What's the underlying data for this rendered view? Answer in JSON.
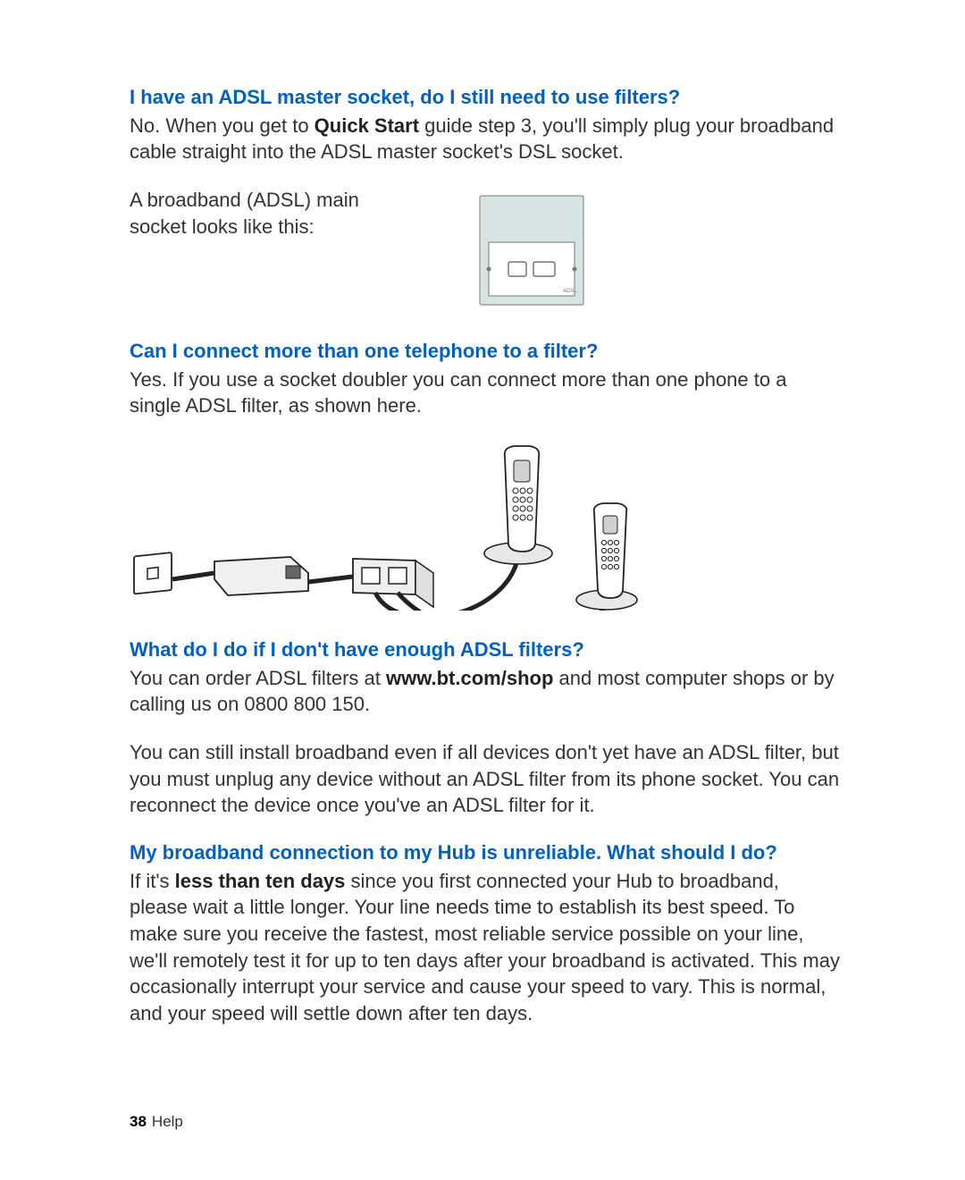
{
  "q1": {
    "question": "I have an ADSL master socket, do I still need to use filters?",
    "answer_pre": "No. When you get to ",
    "answer_bold": "Quick Start",
    "answer_post": " guide step 3, you'll simply plug your broadband cable straight into the ADSL master socket's DSL socket.",
    "caption": "A broadband (ADSL) main socket looks like this:"
  },
  "q2": {
    "question": "Can I connect more than one telephone to a filter?",
    "answer": "Yes. If you use a socket doubler you can connect more than one phone to a single ADSL filter, as shown here."
  },
  "q3": {
    "question": "What do I do if I don't have enough ADSL filters?",
    "p1_pre": "You can order ADSL filters at ",
    "p1_bold": "www.bt.com/shop",
    "p1_post": " and most computer shops or by calling us on 0800 800 150.",
    "p2": "You can still install broadband even if all devices don't yet have an ADSL filter, but you must unplug any device without an ADSL filter from its phone socket. You can reconnect the device once you've an ADSL filter for it."
  },
  "q4": {
    "question": "My broadband connection to my Hub is unreliable. What should I do?",
    "p_pre": "If it's ",
    "p_bold": "less than ten days",
    "p_post": " since you first connected your Hub to broadband, please wait a little longer. Your line needs time to establish its best speed. To make sure you receive the fastest, most reliable service possible on your line, we'll remotely test it for up to ten days after your broadband is activated. This may occasionally interrupt your service and cause your speed to vary. This is normal, and your speed will settle down after ten days."
  },
  "footer": {
    "page": "38",
    "section": "Help"
  }
}
